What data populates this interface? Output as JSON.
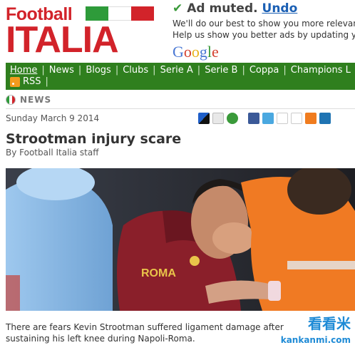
{
  "header": {
    "logo_top": "Football",
    "logo_bottom": "ITALIA",
    "flag_colors": [
      "#2e9b3a",
      "#ffffff",
      "#d2232a"
    ]
  },
  "ad": {
    "muted_label": "Ad muted.",
    "undo_label": "Undo",
    "line1": "We'll do our best to show you more relevant",
    "line2": "Help us show you better ads by updating you",
    "brand": "Google"
  },
  "nav": {
    "items": [
      "Home",
      "News",
      "Blogs",
      "Clubs",
      "Serie A",
      "Serie B",
      "Coppa",
      "Champions L"
    ],
    "rss_label": "RSS"
  },
  "section": {
    "label": "NEWS"
  },
  "article": {
    "date": "Sunday March 9 2014",
    "title": "Strootman injury scare",
    "byline": "By Football Italia staff",
    "caption": "There are fears Kevin Strootman suffered ligament damage after sustaining his left knee during Napoli-Roma.",
    "jersey_text": "ROMA"
  },
  "share": {
    "icons": [
      "delicious-icon",
      "digg-icon",
      "stumbleupon-icon",
      "facebook-icon",
      "twitter-icon",
      "google-icon",
      "yahoo-icon",
      "blogger-icon",
      "linkedin-icon"
    ]
  },
  "watermark": {
    "cn": "看看米",
    "url": "kankanmi.com"
  },
  "colors": {
    "brand_red": "#d2232a",
    "nav_green": "#2f7f1e",
    "link_blue": "#1a5fb4"
  }
}
